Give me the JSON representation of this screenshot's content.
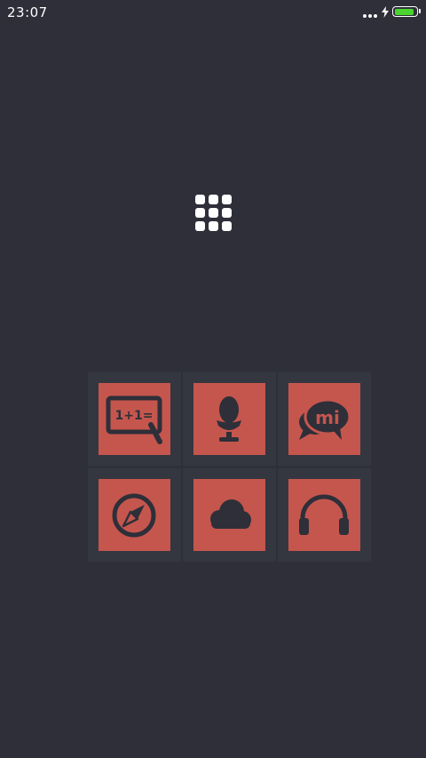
{
  "status_bar": {
    "time": "23:07",
    "signal_icon": "three-dots-icon",
    "charging_icon": "lightning-icon",
    "battery_icon": "battery-icon",
    "battery_level": 1.0,
    "battery_color": "#4bd32f"
  },
  "launcher": {
    "app_drawer_icon": "app-grid-icon"
  },
  "apps": [
    {
      "id": "calculator",
      "icon": "blackboard-calculator-icon",
      "formula": "1+1="
    },
    {
      "id": "egg",
      "icon": "egg-cup-icon"
    },
    {
      "id": "mi-chat",
      "icon": "mi-chat-bubbles-icon",
      "text": "mi"
    },
    {
      "id": "compass",
      "icon": "compass-icon"
    },
    {
      "id": "cloud",
      "icon": "cloud-icon"
    },
    {
      "id": "music",
      "icon": "headphones-icon"
    }
  ],
  "colors": {
    "background": "#2e2f39",
    "panel": "#343640",
    "tile": "#c5564d",
    "glyph": "#2e2f39"
  }
}
